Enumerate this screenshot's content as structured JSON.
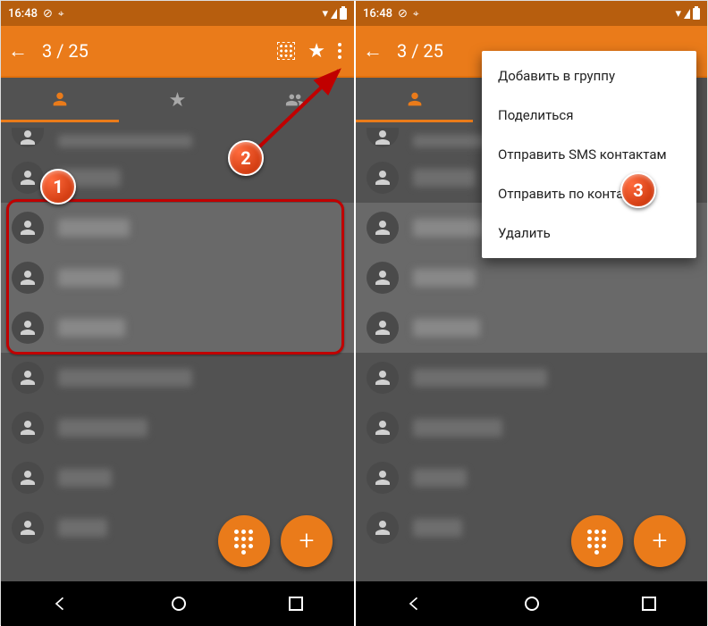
{
  "status": {
    "time": "16:48"
  },
  "actionbar": {
    "title": "3 / 25"
  },
  "menu": {
    "add_group": "Добавить в группу",
    "share": "Поделиться",
    "send_sms": "Отправить SMS контактам",
    "send_to": "Отправить по контактам",
    "delete": "Удалить"
  },
  "callouts": {
    "c1": "1",
    "c2": "2",
    "c3": "3"
  },
  "colors": {
    "accent": "#ea7b1a"
  }
}
